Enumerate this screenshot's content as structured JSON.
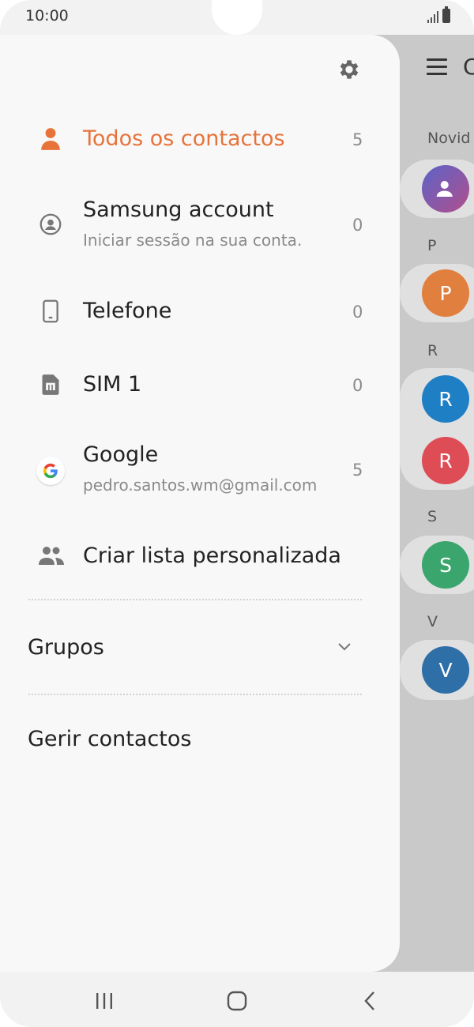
{
  "status_bar": {
    "time": "10:00"
  },
  "background": {
    "title_fragment": "C",
    "sections": [
      {
        "label": "Novid",
        "avatars": [
          {
            "letter": "",
            "color": "#6f5bb8"
          }
        ]
      },
      {
        "label": "P",
        "avatars": [
          {
            "letter": "P",
            "color": "#e07f3e"
          }
        ]
      },
      {
        "label": "R",
        "avatars": [
          {
            "letter": "R",
            "color": "#1f7fc4"
          },
          {
            "letter": "R",
            "color": "#de4c55"
          }
        ]
      },
      {
        "label": "S",
        "avatars": [
          {
            "letter": "S",
            "color": "#3aa56c"
          }
        ]
      },
      {
        "label": "V",
        "avatars": [
          {
            "letter": "V",
            "color": "#2f6fa8"
          }
        ]
      }
    ]
  },
  "drawer": {
    "items": [
      {
        "label": "Todos os contactos",
        "count": "5",
        "icon": "person-icon",
        "active": true
      },
      {
        "label": "Samsung account",
        "sublabel": "Iniciar sessão na sua conta.",
        "count": "0",
        "icon": "samsung-account-icon"
      },
      {
        "label": "Telefone",
        "count": "0",
        "icon": "phone-icon"
      },
      {
        "label": "SIM 1",
        "count": "0",
        "icon": "sim-card-icon"
      },
      {
        "label": "Google",
        "sublabel": "pedro.santos.wm@gmail.com",
        "count": "5",
        "icon": "google-icon"
      },
      {
        "label": "Criar lista personalizada",
        "icon": "group-icon"
      }
    ],
    "groups_label": "Grupos",
    "manage_label": "Gerir contactos"
  },
  "colors": {
    "accent": "#e8733a",
    "drawer_bg": "#f8f8f8",
    "scrim": "#c9c9c9"
  }
}
